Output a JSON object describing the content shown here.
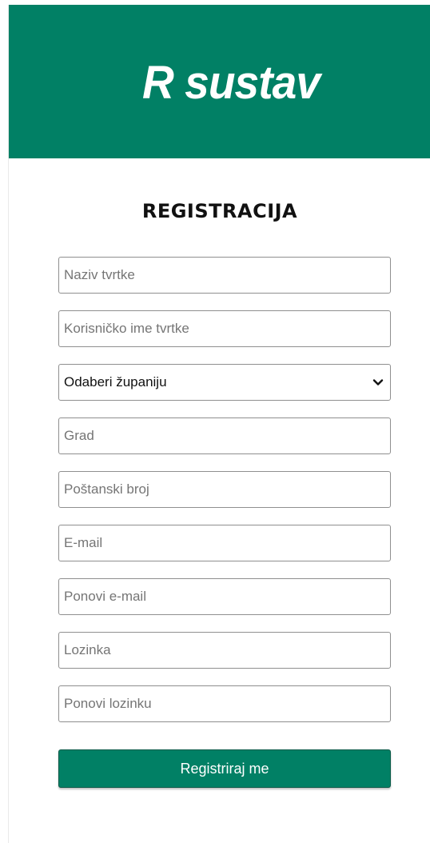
{
  "header": {
    "logo_text": "R sustav"
  },
  "form": {
    "title": "REGISTRACIJA",
    "fields": {
      "company_name": {
        "placeholder": "Naziv tvrtke"
      },
      "company_username": {
        "placeholder": "Korisničko ime tvrtke"
      },
      "county": {
        "selected": "Odaberi županiju"
      },
      "city": {
        "placeholder": "Grad"
      },
      "postal_code": {
        "placeholder": "Poštanski broj"
      },
      "email": {
        "placeholder": "E-mail"
      },
      "email_repeat": {
        "placeholder": "Ponovi e-mail"
      },
      "password": {
        "placeholder": "Lozinka"
      },
      "password_repeat": {
        "placeholder": "Ponovi lozinku"
      }
    },
    "submit_label": "Registriraj me"
  },
  "colors": {
    "brand": "#018065",
    "background": "#ffffff",
    "field_border": "#8f8f8f"
  },
  "icons": {
    "select_arrow": "chevron-down-icon"
  }
}
